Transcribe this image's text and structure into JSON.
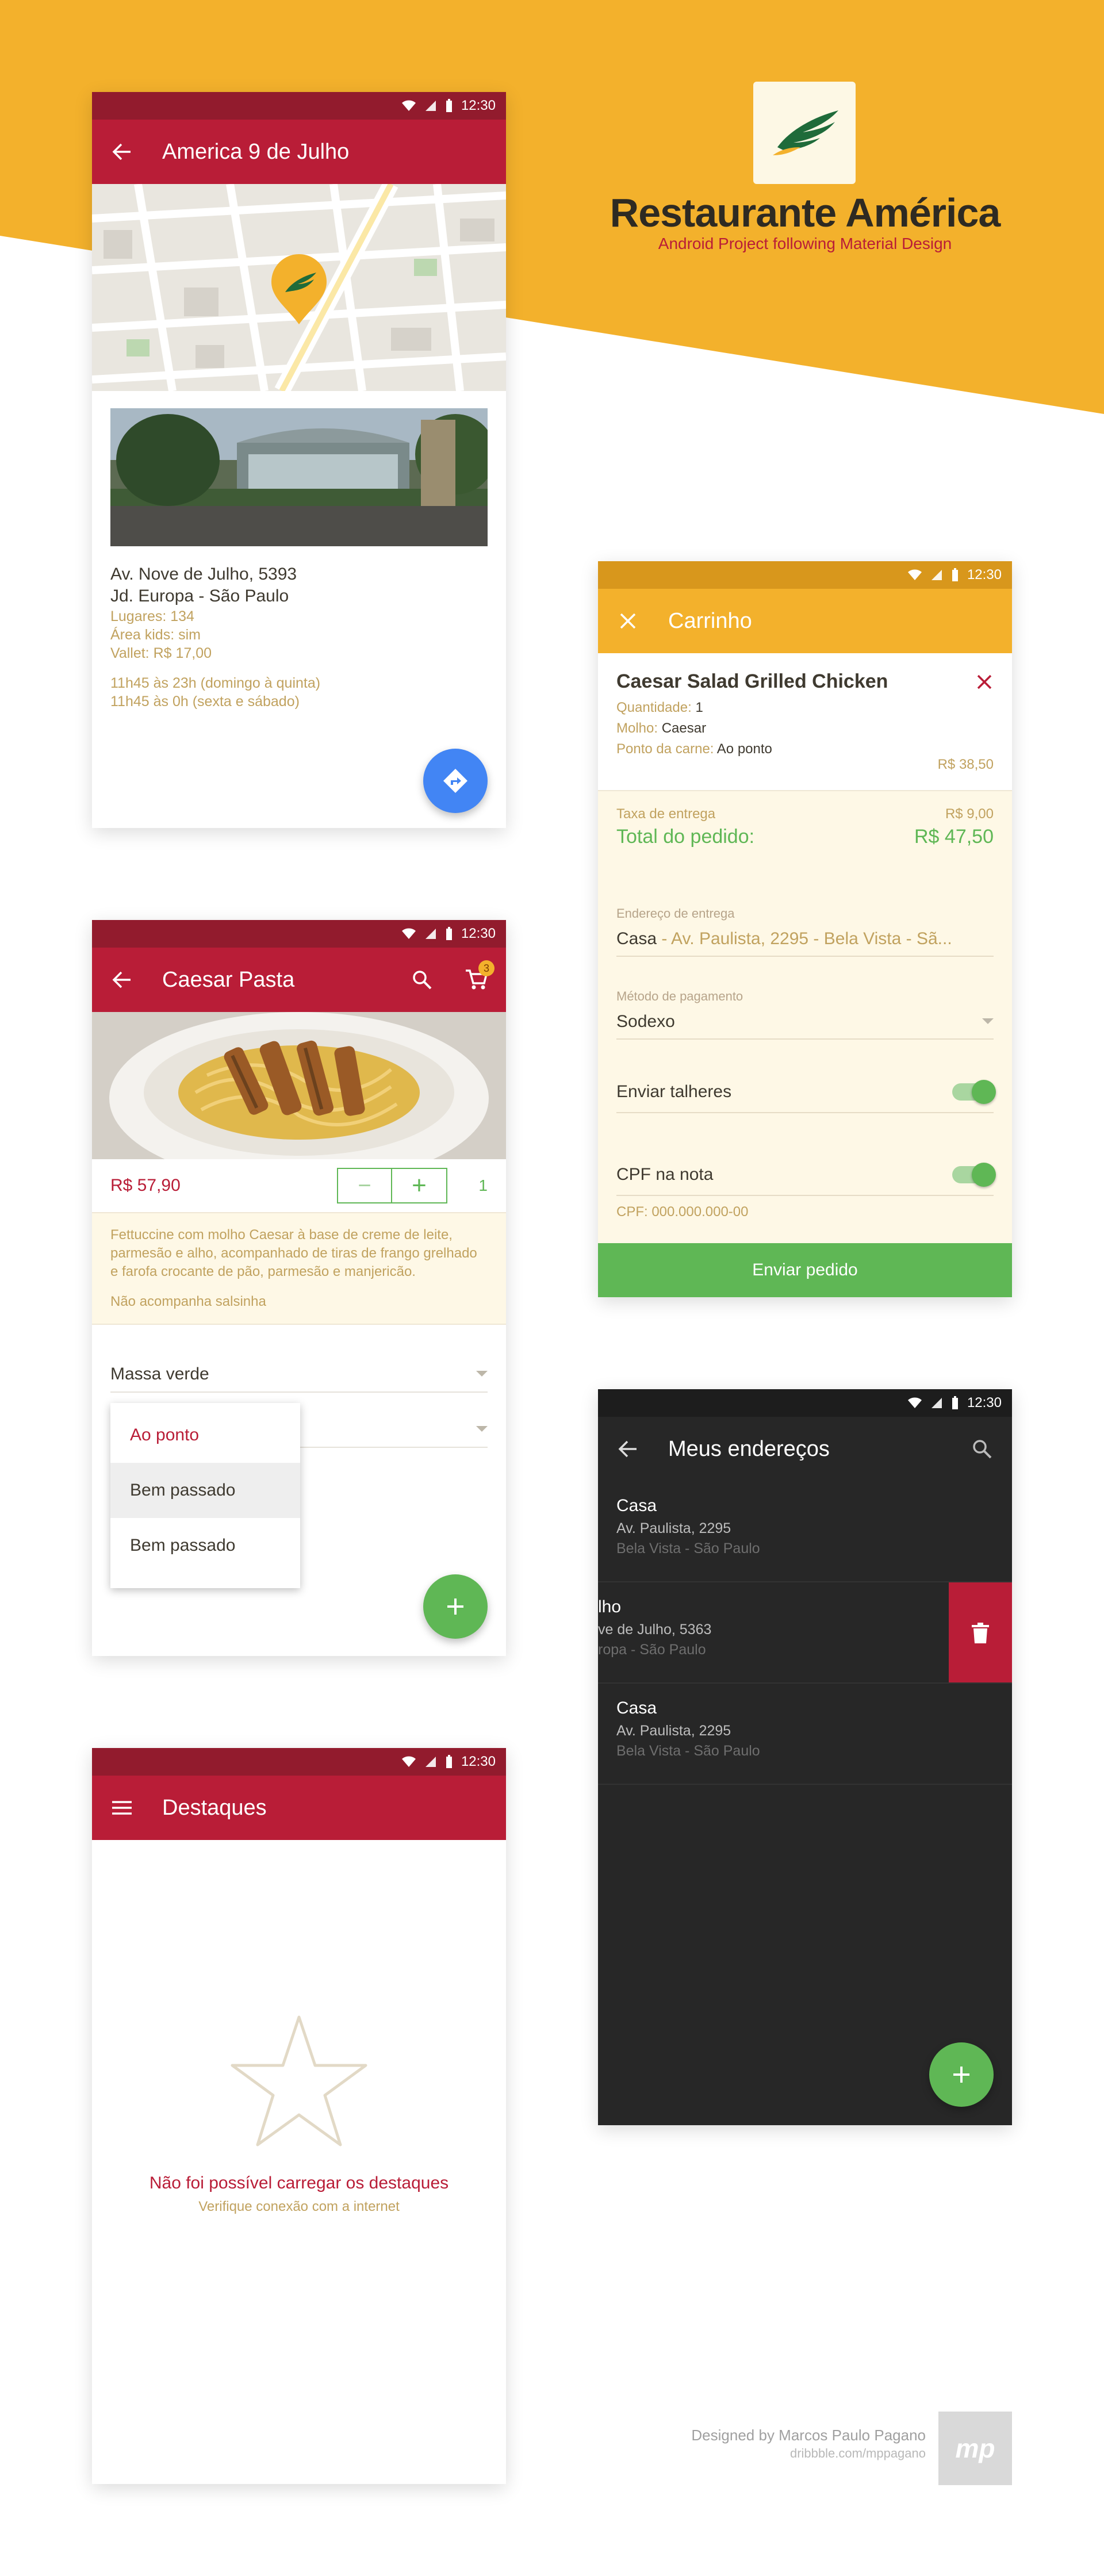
{
  "status_time": "12:30",
  "brand": {
    "title": "Restaurante América",
    "subtitle": "Android Project following Material Design",
    "colors": {
      "yellow": "#f3b12c",
      "red": "#b91d37",
      "green": "#5fb755",
      "dark": "#272727"
    }
  },
  "screen_address": {
    "title": "America 9 de Julho",
    "nav_icon": "arrow-back-icon",
    "map_pin_icon": "america-pin-icon",
    "address_line1": "Av. Nove de Julho, 5393",
    "address_line2": "Jd. Europa - São Paulo",
    "seats": "Lugares: 134",
    "kids_area": "Área kids: sim",
    "valet": "Vallet: R$ 17,00",
    "hours1": "11h45 às 23h (domingo à quinta)",
    "hours2": "11h45 às 0h (sexta e sábado)",
    "fab_icon": "directions-icon"
  },
  "screen_product": {
    "title": "Caesar Pasta",
    "cart_badge": "3",
    "price": "R$ 57,90",
    "minus": "−",
    "plus": "+",
    "quantity": "1",
    "description": "Fettuccine com molho Caesar à base de creme de leite, parmesão e alho, acompanhado de tiras de frango grelhado e farofa crocante de pão, parmesão e manjericão.",
    "note": "Não acompanha salsinha",
    "select1_value": "Massa verde",
    "dropdown_options": [
      "Ao ponto",
      "Bem passado",
      "Bem passado"
    ],
    "fab_icon": "plus-icon"
  },
  "screen_highlights": {
    "title": "Destaques",
    "nav_icon": "menu-icon",
    "empty_icon": "star-outline-icon",
    "error_title": "Não foi possível carregar os destaques",
    "error_subtitle": "Verifique conexão com a internet"
  },
  "screen_cart": {
    "title": "Carrinho",
    "nav_icon": "close-icon",
    "item_name": "Caesar Salad Grilled Chicken",
    "qty_label": "Quantidade:",
    "qty_value": "1",
    "sauce_label": "Molho:",
    "sauce_value": "Caesar",
    "doneness_label": "Ponto da carne:",
    "doneness_value": "Ao ponto",
    "item_price": "R$ 38,50",
    "delivery_label": "Taxa de entrega",
    "delivery_value": "R$ 9,00",
    "total_label": "Total do pedido:",
    "total_value": "R$ 47,50",
    "address_field_label": "Endereço de entrega",
    "address_name": "Casa",
    "address_detail": " - Av. Paulista, 2295 - Bela Vista - Sã...",
    "payment_label": "Método de pagamento",
    "payment_value": "Sodexo",
    "cutlery_label": "Enviar talheres",
    "cpf_label": "CPF na nota",
    "cpf_placeholder": "CPF: 000.000.000-00",
    "submit_label": "Enviar pedido"
  },
  "screen_addresses": {
    "title": "Meus endereços",
    "items": [
      {
        "name": "Casa",
        "street": "Av. Paulista, 2295",
        "area": "Bela Vista - São Paulo"
      },
      {
        "name": "lho",
        "street": "ve de Julho, 5363",
        "area": "ropa - São Paulo"
      },
      {
        "name": "Casa",
        "street": "Av. Paulista, 2295",
        "area": "Bela Vista - São Paulo"
      }
    ],
    "delete_icon": "trash-icon",
    "fab_icon": "plus-icon"
  },
  "credits": {
    "designer": "Designed by Marcos Paulo Pagano",
    "url": "dribbble.com/mppagano",
    "logo": "mp"
  }
}
